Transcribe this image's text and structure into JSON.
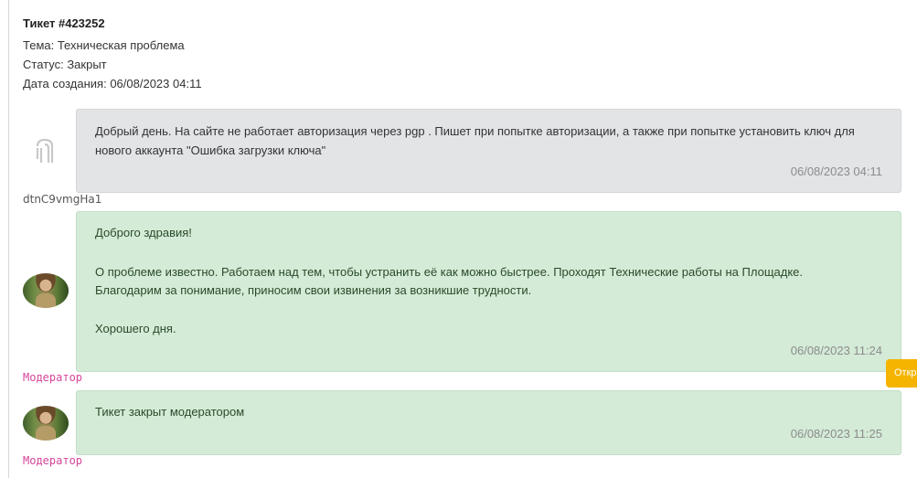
{
  "ticket": {
    "title": "Тикет #423252",
    "subject_line": "Тема: Техническая проблема",
    "status_line": "Статус: Закрыт",
    "created_line": "Дата создания: 06/08/2023 04:11"
  },
  "messages": [
    {
      "author": "dtnC9vmgHa1",
      "text": "Добрый день. На сайте не работает авторизация через pgp . Пишет при попытке авторизации, а также при попытке установить ключ для нового аккаунта \"Ошибка загрузки ключа\"",
      "time": "06/08/2023 04:11",
      "icon": "user-logo-icon"
    },
    {
      "author": "Модератор",
      "greeting": "Доброго здравия!",
      "body_1": "О проблеме известно. Работаем над тем, чтобы устранить её как можно быстрее. Проходят Технические работы на Площадке.",
      "body_2": "Благодарим за понимание, приносим свои извинения за возникшие трудности.",
      "closing": "Хорошего дня.",
      "time": "06/08/2023 11:24",
      "icon": "moderator-avatar"
    },
    {
      "author": "Модератор",
      "text": "Тикет закрыт модератором",
      "time": "06/08/2023 11:25",
      "icon": "moderator-avatar"
    }
  ],
  "side_tab": {
    "label": "Откр"
  },
  "colors": {
    "user_bubble": "#e3e4e6",
    "moderator_bubble": "#d4ebd7",
    "moderator_name": "#d6459b",
    "tab": "#f5b400"
  }
}
